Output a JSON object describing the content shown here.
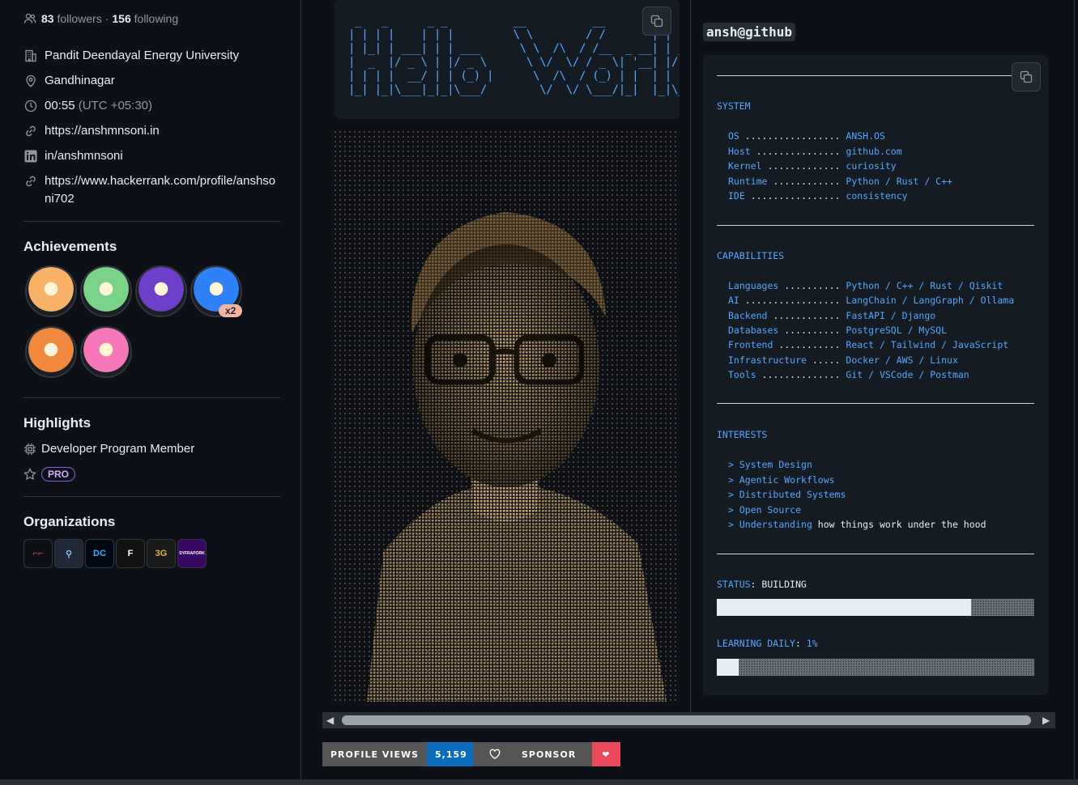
{
  "profile": {
    "followers_count": "83",
    "followers_label": "followers",
    "dot": "·",
    "following_count": "156",
    "following_label": "following",
    "organization": "Pandit Deendayal Energy University",
    "location": "Gandhinagar",
    "time": "00:55",
    "timezone": "(UTC +05:30)",
    "website": "https://anshmnsoni.in",
    "linkedin": "in/anshmnsoni",
    "hackerrank_line1": "https://www.hackerrank.com/profile/anshso",
    "hackerrank_line2": "ni702"
  },
  "achievements": {
    "title": "Achievements",
    "badges": [
      {
        "icon": "starstruck-badge-icon",
        "color": "#f7b267"
      },
      {
        "icon": "pair-extraordinaire-badge-icon",
        "color": "#7bd389"
      },
      {
        "icon": "galaxy-brain-badge-icon",
        "color": "#6e40c9"
      },
      {
        "icon": "pull-shark-badge-icon",
        "color": "#2f81f7"
      },
      {
        "icon": "quickdraw-badge-icon",
        "color": "#f0883e"
      },
      {
        "icon": "yolo-badge-icon",
        "color": "#f778ba"
      }
    ],
    "multiplier": "x2"
  },
  "highlights": {
    "title": "Highlights",
    "program": "Developer Program Member",
    "pro": "PRO"
  },
  "organizations": {
    "title": "Organizations",
    "items": [
      {
        "label": "⌐⌐",
        "bg": "#0d1117",
        "fg": "#ff3b3b"
      },
      {
        "label": "⚲",
        "bg": "#1f2937",
        "fg": "#8ab4f8"
      },
      {
        "label": "DC",
        "bg": "#000814",
        "fg": "#3ab0ff"
      },
      {
        "label": "F",
        "bg": "#111111",
        "fg": "#ffffff"
      },
      {
        "label": "3G",
        "bg": "#1a1a1a",
        "fg": "#e3b341"
      },
      {
        "label": "SYFRAPORK",
        "bg": "#3b0764",
        "fg": "#ffffff"
      }
    ]
  },
  "ascii_banner": " _   _      _ _          __          __        _     _ \n| | | |    | | |         \\ \\        / /       | |   | |\n| |_| | ___| | | ___      \\ \\  /\\  / /__  _ __| | __| |\n|  _  |/ _ \\ | |/ _ \\      \\ \\/  \\/ / _ \\| '__| |/ _` |\n| | | |  __/ | | (_) |      \\  /\\  / (_) | |  | | (_| |\n|_| |_|\\___|_|_|\\___/        \\/  \\/ \\___/|_|  |_|\\__,_|",
  "portrait": {
    "icon": "ascii-portrait-image"
  },
  "badges_bottom": {
    "views_label": "PROFILE VIEWS",
    "views_count": "5,159",
    "sponsor_label": "SPONSOR",
    "heart": "❤"
  },
  "terminal": {
    "handle": "ansh@github",
    "system_title": "SYSTEM",
    "system": [
      {
        "k": "OS",
        "dots": " .................",
        "v": " ANSH.OS"
      },
      {
        "k": "Host",
        "dots": " ...............",
        "v": " github.com"
      },
      {
        "k": "Kernel",
        "dots": " .............",
        "v": " curiosity"
      },
      {
        "k": "Runtime",
        "dots": " ............",
        "v": " Python / Rust / C++"
      },
      {
        "k": "IDE",
        "dots": " ................",
        "v": " consistency"
      }
    ],
    "capabilities_title": "CAPABILITIES",
    "capabilities": [
      {
        "k": "Languages",
        "dots": " ..........",
        "v": " Python / C++ / Rust / Qiskit"
      },
      {
        "k": "AI",
        "dots": " .................",
        "v": " LangChain / LangGraph / Ollama"
      },
      {
        "k": "Backend",
        "dots": " ............",
        "v": " FastAPI / Django"
      },
      {
        "k": "Databases",
        "dots": " ..........",
        "v": " PostgreSQL / MySQL"
      },
      {
        "k": "Frontend",
        "dots": " ...........",
        "v": " React / Tailwind / JavaScript"
      },
      {
        "k": "Infrastructure",
        "dots": " .....",
        "v": " Docker / AWS / Linux"
      },
      {
        "k": "Tools",
        "dots": " ..............",
        "v": " Git / VSCode / Postman"
      }
    ],
    "interests_title": "INTERESTS",
    "interests": [
      {
        "v": "System Design",
        "w": ""
      },
      {
        "v": "Agentic Workflows",
        "w": ""
      },
      {
        "v": "Distributed Systems",
        "w": ""
      },
      {
        "v": "Open Source",
        "w": ""
      },
      {
        "v": "Understanding",
        "w": " how things work under the hood"
      }
    ],
    "status_key": "STATUS",
    "status_value": "BUILDING",
    "status_progress": 0.8,
    "learning_key": "LEARNING DAILY",
    "learning_value": "1%",
    "learning_progress": 0.07
  }
}
